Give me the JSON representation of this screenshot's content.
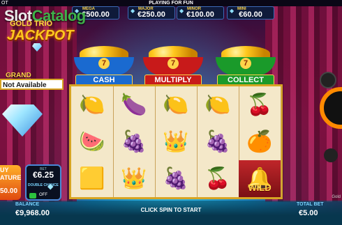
{
  "top_bar": {
    "playing_for_fun": "PLAYING FOR FUN",
    "menu_glyph": "OT"
  },
  "watermark": {
    "slot": "Slot",
    "catalog": "Catalog"
  },
  "jackpots": [
    {
      "name": "MEGA",
      "value": "€500.00"
    },
    {
      "name": "MAJOR",
      "value": "€250.00"
    },
    {
      "name": "MINOR",
      "value": "€100.00"
    },
    {
      "name": "MINI",
      "value": "€60.00"
    }
  ],
  "game_logo": {
    "line1": "GOLD TRIO",
    "line2": "JACKPOT"
  },
  "grand": {
    "label": "GRAND",
    "value": "Not Available"
  },
  "pots": [
    {
      "label": "CASH",
      "number": "7",
      "color": "#1a6ad0"
    },
    {
      "label": "MULTIPLY",
      "number": "7",
      "color": "#c81a1a"
    },
    {
      "label": "COLLECT",
      "number": "7",
      "color": "#1a9a2a"
    }
  ],
  "reels": [
    [
      "lemon",
      "watermelon",
      "gold-bar"
    ],
    [
      "plum",
      "grapes",
      "crown"
    ],
    [
      "lemon",
      "crown",
      "grapes"
    ],
    [
      "lemon",
      "grapes",
      "cherries"
    ],
    [
      "cherries",
      "orange",
      "wild-bell"
    ]
  ],
  "symbol_glyphs": {
    "lemon": "🍋",
    "watermelon": "🍉",
    "gold-bar": "🟨",
    "plum": "🍆",
    "grapes": "🍇",
    "crown": "👑",
    "cherries": "🍒",
    "orange": "🍊",
    "wild-bell": "🔔"
  },
  "wild_label": "WILD",
  "buy_feature": {
    "line1": "UY",
    "line2": "ATURE",
    "price": "50.00"
  },
  "bet_panel": {
    "label": "BET",
    "value": "€6.25",
    "double_chance": "DOUBLE CHANCE",
    "off": "OFF"
  },
  "footer": {
    "balance_label": "BALANCE",
    "balance_value": "€9,968.00",
    "message": "CLICK SPIN TO START",
    "total_bet_label": "TOTAL BET",
    "total_bet_value": "€5.00",
    "provider_mark": "Gold"
  }
}
